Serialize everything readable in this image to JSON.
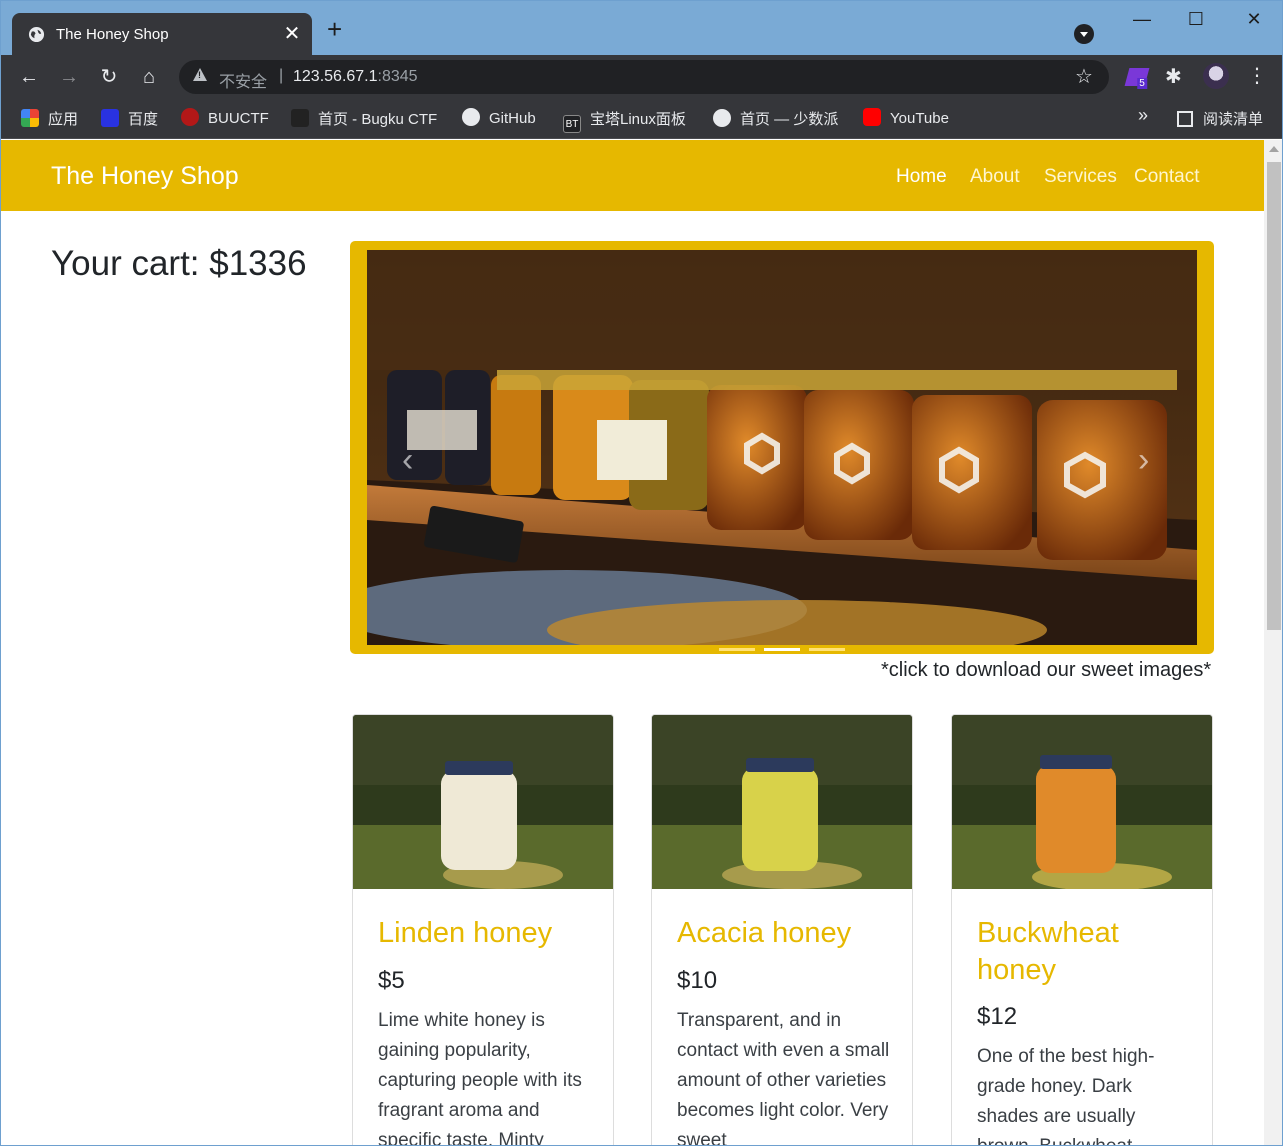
{
  "browser": {
    "tab_title": "The Honey Shop",
    "tab_close": "✕",
    "new_tab": "+",
    "url_security": "不安全",
    "url_host": "123.56.67.1",
    "url_port": ":8345",
    "extension_badge": "5",
    "bookmarks": [
      "应用",
      "百度",
      "BUUCTF",
      "首页 - Bugku CTF",
      "GitHub",
      "宝塔Linux面板",
      "首页 — 少数派",
      "YouTube"
    ],
    "bt_icon_text": "BT",
    "bookmarks_more": "»",
    "reading_list": "阅读清单"
  },
  "navbar": {
    "brand": "The Honey Shop",
    "links": [
      "Home",
      "About",
      "Services",
      "Contact"
    ],
    "active": "Home"
  },
  "cart": {
    "text": "Your cart: $1336"
  },
  "carousel": {
    "caption": "*click to download our sweet images*",
    "indicators": 3,
    "active_indicator": 1
  },
  "products": [
    {
      "name": "Linden honey",
      "price": "$5",
      "description": "Lime white honey is gaining popularity, capturing people with its fragrant aroma and specific taste. Minty",
      "jar_color": "#efe9d6"
    },
    {
      "name": "Acacia honey",
      "price": "$10",
      "description": "Transparent, and in contact with even a small amount of other varieties becomes light color. Very sweet",
      "jar_color": "#d8d24a"
    },
    {
      "name": "Buckwheat honey",
      "price": "$12",
      "description": "One of the best high-grade honey. Dark shades are usually brown. Buckwheat",
      "jar_color": "#e08a2a"
    }
  ],
  "colors": {
    "brand_yellow": "#e6b800",
    "chrome_dark": "#35363a",
    "titlebar": "#7aaad5"
  }
}
